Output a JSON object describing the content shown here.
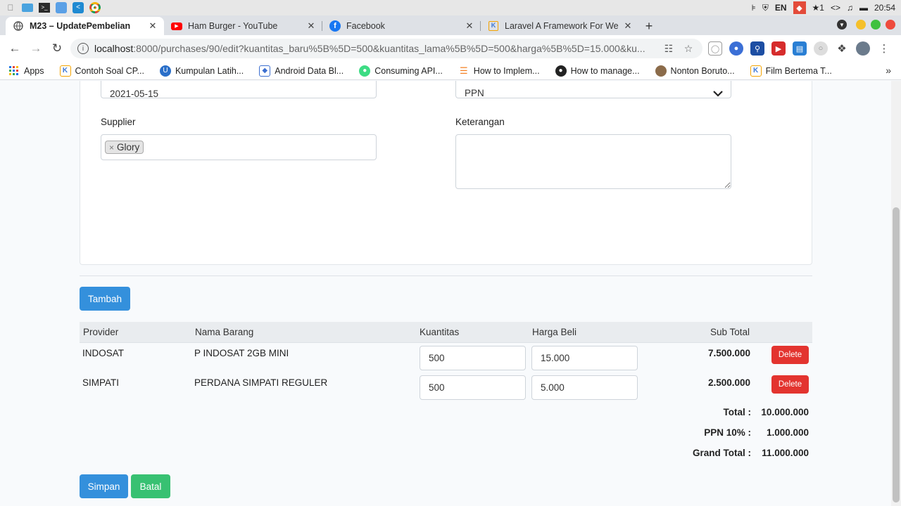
{
  "os": {
    "lang": "EN",
    "notif_count": "1",
    "time": "20:54"
  },
  "tabs": [
    {
      "title": "M23 – UpdatePembelian",
      "active": true
    },
    {
      "title": "Ham Burger - YouTube",
      "active": false
    },
    {
      "title": "Facebook",
      "active": false
    },
    {
      "title": "Laravel A Framework For We",
      "active": false
    }
  ],
  "address": {
    "host": "localhost",
    "path": ":8000/purchases/90/edit?kuantitas_baru%5B%5D=500&kuantitas_lama%5B%5D=500&harga%5B%5D=15.000&ku..."
  },
  "bookmarks": [
    {
      "label": "Apps"
    },
    {
      "label": "Contoh Soal CP..."
    },
    {
      "label": "Kumpulan Latih..."
    },
    {
      "label": "Android Data Bl..."
    },
    {
      "label": "Consuming API..."
    },
    {
      "label": "How to Implem..."
    },
    {
      "label": "How to manage..."
    },
    {
      "label": "Nonton Boruto..."
    },
    {
      "label": "Film Bertema T..."
    }
  ],
  "form": {
    "date_value": "2021-05-15",
    "tax_value": "PPN",
    "supplier_label": "Supplier",
    "supplier_tag": "Glory",
    "notes_label": "Keterangan",
    "notes_value": ""
  },
  "add_button": "Tambah",
  "table": {
    "headers": {
      "provider": "Provider",
      "item": "Nama Barang",
      "qty": "Kuantitas",
      "price": "Harga Beli",
      "subtotal": "Sub Total"
    },
    "rows": [
      {
        "provider": "INDOSAT",
        "item": "P INDOSAT 2GB MINI",
        "qty": "500",
        "price": "15.000",
        "subtotal": "7.500.000",
        "delete": "Delete"
      },
      {
        "provider": "SIMPATI",
        "item": "PERDANA SIMPATI REGULER",
        "qty": "500",
        "price": "5.000",
        "subtotal": "2.500.000",
        "delete": "Delete"
      }
    ]
  },
  "summary": {
    "total_label": "Total :",
    "total_value": "10.000.000",
    "ppn_label": "PPN 10% :",
    "ppn_value": "1.000.000",
    "grand_label": "Grand Total :",
    "grand_value": "11.000.000"
  },
  "actions": {
    "save": "Simpan",
    "cancel": "Batal"
  },
  "colors": {
    "primary": "#3490dc",
    "success": "#38c172",
    "danger": "#e3342f"
  }
}
